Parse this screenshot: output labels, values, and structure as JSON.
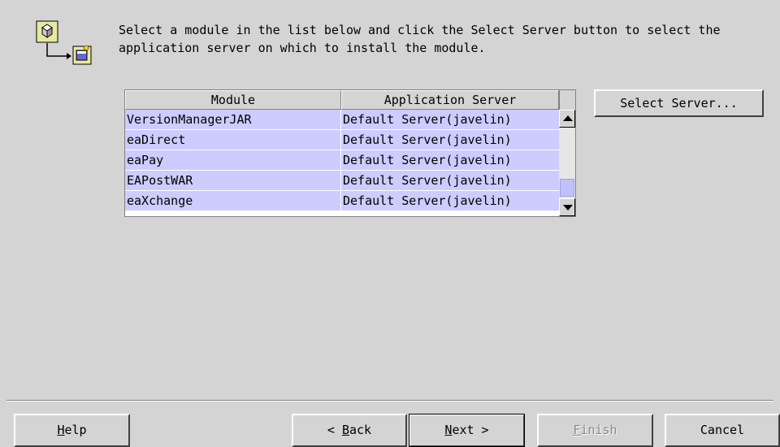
{
  "instruction": "Select a module in the list below and click the Select Server button to select the\napplication server on which to install the module.",
  "table": {
    "headers": {
      "module": "Module",
      "server": "Application Server"
    },
    "rows": [
      {
        "module": "VersionManagerJAR",
        "server": "Default Server(javelin)"
      },
      {
        "module": "eaDirect",
        "server": "Default Server(javelin)"
      },
      {
        "module": "eaPay",
        "server": "Default Server(javelin)"
      },
      {
        "module": "EAPostWAR",
        "server": "Default Server(javelin)"
      },
      {
        "module": "eaXchange",
        "server": "Default Server(javelin)"
      }
    ]
  },
  "select_server_label": "Select Server...",
  "buttons": {
    "help": {
      "mnemonic": "H",
      "rest": "elp"
    },
    "back": {
      "prefix": "< ",
      "mnemonic": "B",
      "rest": "ack"
    },
    "next": {
      "mnemonic": "N",
      "rest": "ext >"
    },
    "finish": {
      "mnemonic": "F",
      "rest": "inish"
    },
    "cancel": "Cancel"
  },
  "colors": {
    "background": "#d4d4d4",
    "row_highlight": "#ccccff",
    "scroll_thumb": "#c0c0ff"
  },
  "icons": [
    "module-box-icon",
    "arrow-connector-icon",
    "application-server-icon"
  ]
}
